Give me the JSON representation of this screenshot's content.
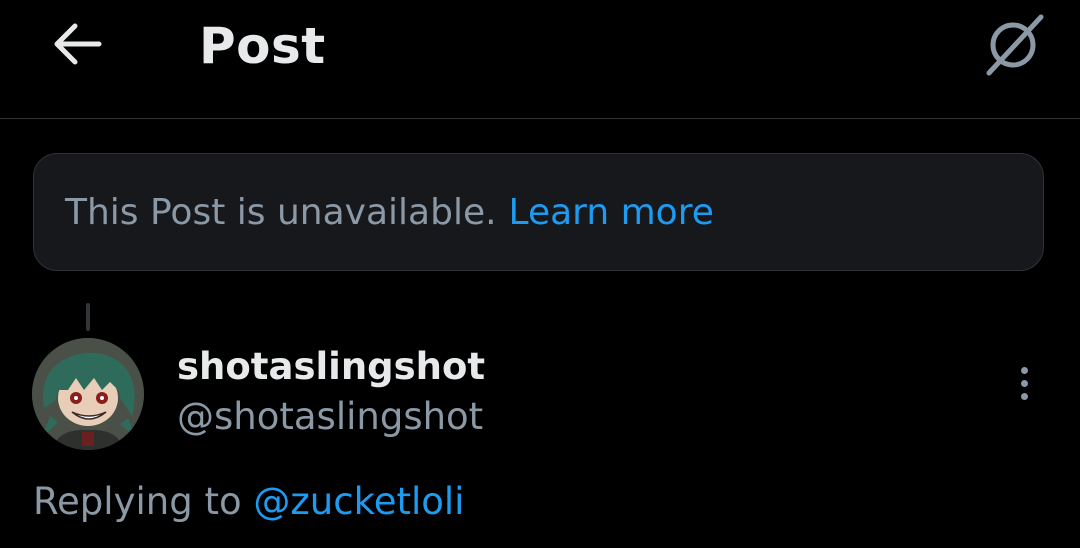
{
  "header": {
    "title": "Post",
    "back_icon": "back-arrow-icon",
    "right_icon": "grok-icon"
  },
  "notice": {
    "text": "This Post is unavailable.",
    "link": "Learn more"
  },
  "author": {
    "display_name": "shotaslingshot",
    "handle": "@shotaslingshot"
  },
  "reply": {
    "prefix": "Replying to",
    "mention": "@zucketloli"
  },
  "colors": {
    "background": "#000000",
    "text_primary": "#e7e9ea",
    "text_secondary": "#8b98a5",
    "accent": "#1d9bf0",
    "card_bg": "#16181c",
    "border": "#2f3336"
  }
}
